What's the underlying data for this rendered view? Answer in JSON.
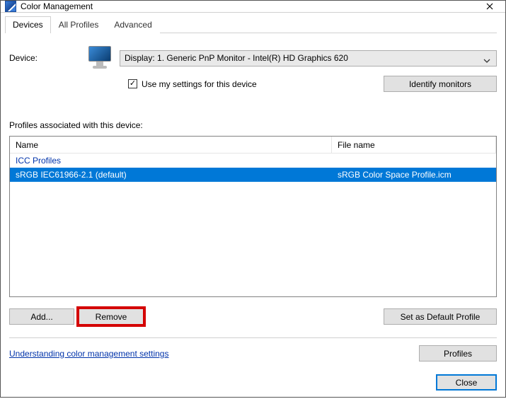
{
  "window": {
    "title": "Color Management"
  },
  "tabs": {
    "devices": "Devices",
    "all_profiles": "All Profiles",
    "advanced": "Advanced"
  },
  "device": {
    "label": "Device:",
    "selected": "Display: 1. Generic PnP Monitor - Intel(R) HD Graphics 620",
    "use_my_settings": "Use my settings for this device",
    "use_my_settings_checked": true,
    "identify": "Identify monitors"
  },
  "profiles_section": {
    "label": "Profiles associated with this device:",
    "columns": {
      "name": "Name",
      "filename": "File name"
    },
    "group": "ICC Profiles",
    "rows": [
      {
        "name": "sRGB IEC61966-2.1 (default)",
        "filename": "sRGB Color Space Profile.icm",
        "selected": true
      }
    ]
  },
  "buttons": {
    "add": "Add...",
    "remove": "Remove",
    "set_default": "Set as Default Profile",
    "profiles": "Profiles",
    "close": "Close"
  },
  "link": {
    "understanding": "Understanding color management settings"
  }
}
